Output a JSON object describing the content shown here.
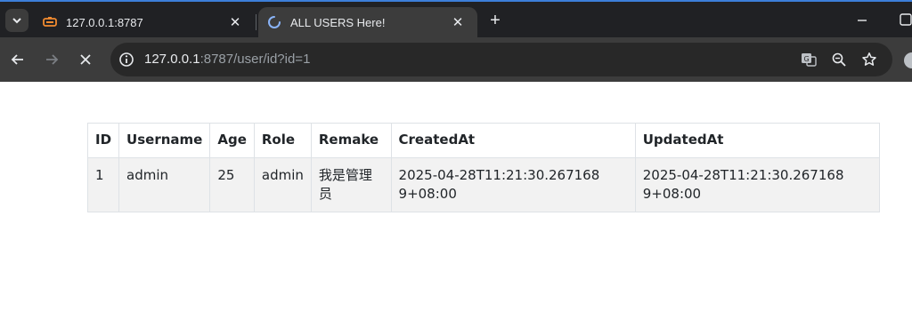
{
  "browser": {
    "tabs": [
      {
        "title": "127.0.0.1:8787",
        "active": false
      },
      {
        "title": "ALL USERS Here!",
        "active": true,
        "loading": true
      }
    ],
    "new_tab_label": "+",
    "address": {
      "host": "127.0.0.1",
      "rest": ":8787/user/id?id=1"
    }
  },
  "table": {
    "headers": [
      "ID",
      "Username",
      "Age",
      "Role",
      "Remake",
      "CreatedAt",
      "UpdatedAt"
    ],
    "rows": [
      [
        "1",
        "admin",
        "25",
        "admin",
        "我是管理员",
        "2025-04-28T11:21:30.2671689+08:00",
        "2025-04-28T11:21:30.2671689+08:00"
      ]
    ]
  },
  "colors": {
    "tabstrip": "#202124",
    "toolbar": "#3c3c3c",
    "omnibox": "#282828",
    "table_border": "#dee2e6",
    "row_bg": "#f2f2f2"
  }
}
